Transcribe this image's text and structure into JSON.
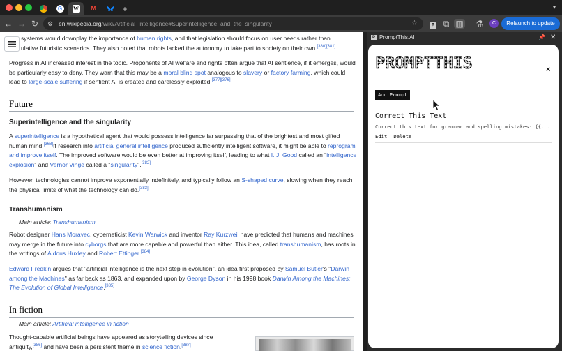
{
  "browser": {
    "tabs": [
      {
        "icon": "chrome-icon",
        "label": ""
      },
      {
        "icon": "google-icon",
        "label": ""
      },
      {
        "icon": "wikipedia-icon",
        "label": "W"
      },
      {
        "icon": "gmail-icon",
        "label": "M"
      },
      {
        "icon": "bluesky-icon",
        "label": ""
      }
    ],
    "new_tab_label": "+",
    "url_domain": "en.wikipedia.org",
    "url_path": "/wiki/Artificial_intelligence#Superintelligence_and_the_singularity",
    "relaunch_label": "Relaunch to update",
    "avatar_letter": "C",
    "colors": {
      "relaunch": "#1a6bd6",
      "link": "#3366cc"
    }
  },
  "article": {
    "p1_pre": "systems would downplay the importance of ",
    "p1_link1": "human rights",
    "p1_mid": ", and that legislation should focus on user needs rather than",
    "p1_line2_pre": "ulative futuristic scenarios. They also noted that robots lacked the autonomy to take part to society on their own.",
    "p1_sup": "[380][381]",
    "p2_a": "Progress in AI increased interest in the topic. Proponents of AI welfare and rights often argue that AI sentience, if it emerges, would",
    "p2_b": "be particularly easy to deny. They warn that this may be a ",
    "p2_link1": "moral blind spot",
    "p2_c": " analogous to ",
    "p2_link2": "slavery",
    "p2_d": " or ",
    "p2_link3": "factory farming",
    "p2_e": ", which could",
    "p2_f": "lead to ",
    "p2_link4": "large-scale suffering",
    "p2_g": " if sentient AI is created and carelessly exploited.",
    "p2_sup": "[377][376]",
    "h_future": "Future",
    "h_super": "Superintelligence and the singularity",
    "p3_a": "A ",
    "p3_link1": "superintelligence",
    "p3_b": " is a hypothetical agent that would possess intelligence far surpassing that of the brightest and most gifted",
    "p3_c": "human mind.",
    "p3_sup1": "[368]",
    "p3_d": "If research into ",
    "p3_link2": "artificial general intelligence",
    "p3_e": " produced sufficiently intelligent software, it might be able to ",
    "p3_link3": "reprogram",
    "p3_link3b": "and improve itself",
    "p3_f": ". The improved software would be even better at improving itself, leading to what ",
    "p3_link4": "I. J. Good",
    "p3_g": " called an \"",
    "p3_link5": "intelligence",
    "p3_link5b": "explosion",
    "p3_h": "\" and ",
    "p3_link6": "Vernor Vinge",
    "p3_i": " called a \"",
    "p3_link7": "singularity",
    "p3_j": "\".",
    "p3_sup2": "[382]",
    "p4_a": "However, technologies cannot improve exponentially indefinitely, and typically follow an ",
    "p4_link1": "S-shaped curve",
    "p4_b": ", slowing when they reach",
    "p4_c": "the physical limits of what the technology can do.",
    "p4_sup": "[383]",
    "h_trans": "Transhumanism",
    "hat1_pre": "Main article: ",
    "hat1_link": "Transhumanism",
    "p5_a": "Robot designer ",
    "p5_link1": "Hans Moravec",
    "p5_b": ", cyberneticist ",
    "p5_link2": "Kevin Warwick",
    "p5_c": " and inventor ",
    "p5_link3": "Ray Kurzweil",
    "p5_d": " have predicted that humans and machines",
    "p5_e": "may merge in the future into ",
    "p5_link4": "cyborgs",
    "p5_f": " that are more capable and powerful than either. This idea, called ",
    "p5_link5": "transhumanism",
    "p5_g": ", has roots in",
    "p5_h": "the writings of ",
    "p5_link6": "Aldous Huxley",
    "p5_i": " and ",
    "p5_link7": "Robert Ettinger",
    "p5_j": ".",
    "p5_sup": "[384]",
    "p6_link1": "Edward Fredkin",
    "p6_a": " argues that \"artificial intelligence is the next step in evolution\", an idea first proposed by ",
    "p6_link2": "Samuel Butler",
    "p6_b": "'s \"",
    "p6_link3": "Darwin",
    "p6_link3b": "among the Machines",
    "p6_c": "\" as far back as 1863, and expanded upon by ",
    "p6_link4": "George Dyson",
    "p6_d": " in his 1998 book ",
    "p6_link5": "Darwin Among the Machines:",
    "p6_link5b": "The Evolution of Global Intelligence",
    "p6_e": ".",
    "p6_sup": "[385]",
    "h_fiction": "In fiction",
    "hat2_pre": "Main article: ",
    "hat2_link": "Artificial intelligence in fiction",
    "p7_a": "Thought-capable artificial beings have appeared as storytelling devices since",
    "p7_b": "antiquity,",
    "p7_sup1": "[386]",
    "p7_c": " and have been a persistent theme in ",
    "p7_link1": "science fiction",
    "p7_d": ".",
    "p7_sup2": "[387]"
  },
  "sidepanel": {
    "header_title": "PromptThis.AI",
    "logo_text": "PROMPTTHIS",
    "close_label": "×",
    "add_button": "Add Prompt",
    "prompts": [
      {
        "title": "Correct This Text",
        "text": "Correct this text for grammar and spelling mistakes: {{...",
        "edit": "Edit",
        "delete": "Delete"
      }
    ]
  }
}
